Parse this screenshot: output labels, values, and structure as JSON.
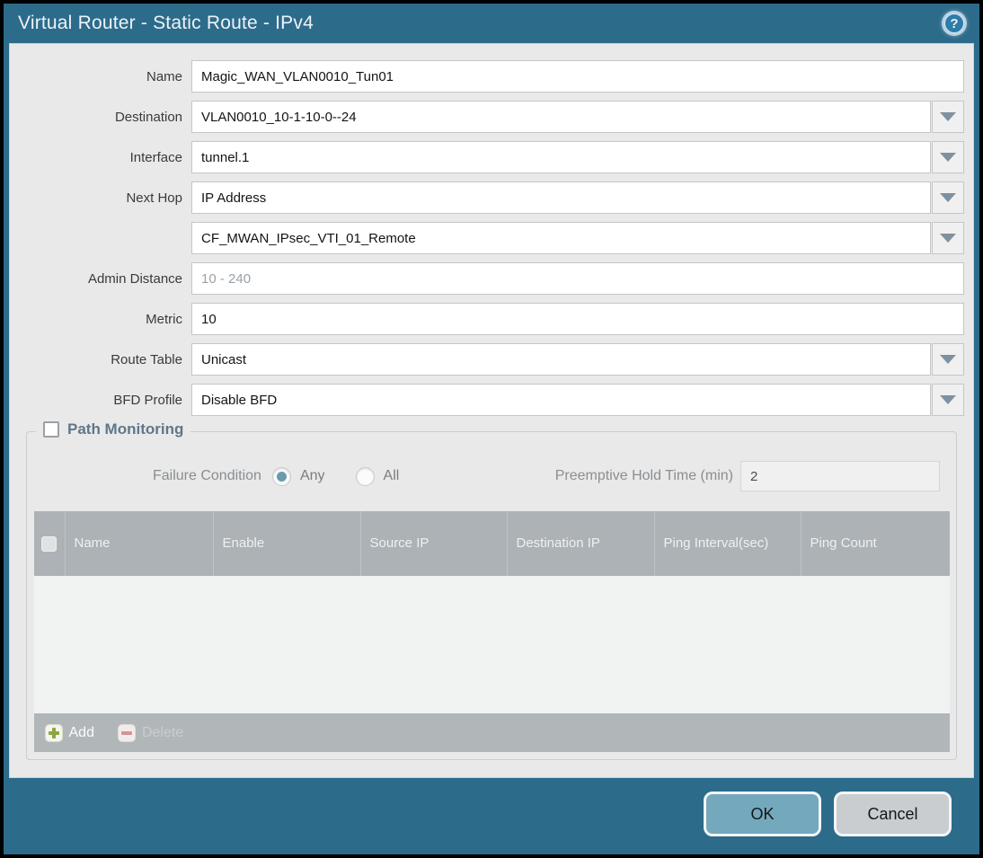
{
  "window": {
    "title": "Virtual Router - Static Route - IPv4",
    "help_glyph": "?"
  },
  "form": {
    "fields": [
      {
        "label": "Name",
        "value": "Magic_WAN_VLAN0010_Tun01",
        "type": "text"
      },
      {
        "label": "Destination",
        "value": "VLAN0010_10-1-10-0--24",
        "type": "dropdown"
      },
      {
        "label": "Interface",
        "value": "tunnel.1",
        "type": "dropdown"
      },
      {
        "label": "Next Hop",
        "value": "IP Address",
        "type": "dropdown"
      },
      {
        "label": "",
        "value": "CF_MWAN_IPsec_VTI_01_Remote",
        "type": "dropdown"
      },
      {
        "label": "Admin Distance",
        "value": "",
        "placeholder": "10 - 240",
        "type": "text"
      },
      {
        "label": "Metric",
        "value": "10",
        "type": "text"
      },
      {
        "label": "Route Table",
        "value": "Unicast",
        "type": "dropdown"
      },
      {
        "label": "BFD Profile",
        "value": "Disable BFD",
        "type": "dropdown"
      }
    ]
  },
  "path_monitoring": {
    "legend": "Path Monitoring",
    "enabled": false,
    "failure_condition_label": "Failure Condition",
    "failure_options": [
      {
        "label": "Any",
        "selected": true
      },
      {
        "label": "All",
        "selected": false
      }
    ],
    "hold_time_label": "Preemptive Hold Time (min)",
    "hold_time_value": "2",
    "table": {
      "headers": [
        "Name",
        "Enable",
        "Source IP",
        "Destination IP",
        "Ping Interval(sec)",
        "Ping Count"
      ],
      "rows": []
    },
    "add_label": "Add",
    "delete_label": "Delete"
  },
  "footer": {
    "ok_label": "OK",
    "cancel_label": "Cancel"
  },
  "colors": {
    "titlebar": "#2d6b8b",
    "panel_bg": "#e9e9e9",
    "table_header_bg": "#acb2b5",
    "ok_button": "#74a8bd",
    "cancel_button": "#c9cdd0",
    "add_icon_green": "#8aa83f",
    "delete_icon_red": "#d49494",
    "radio_selected": "#6b99ad",
    "legend_text": "#5f7789"
  }
}
